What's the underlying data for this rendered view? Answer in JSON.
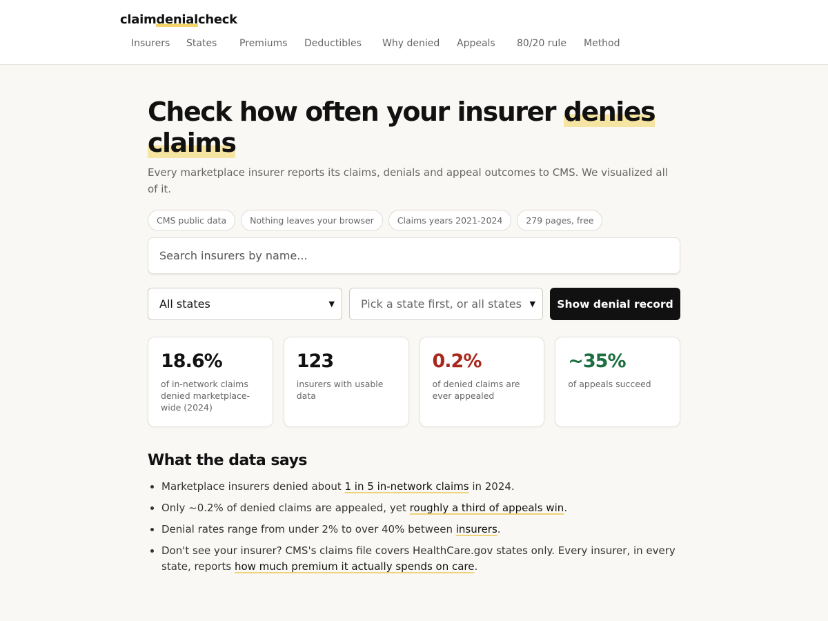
{
  "header": {
    "logo": {
      "part1": "claim",
      "part2": "denial",
      "part3": "check"
    },
    "nav": [
      "Insurers",
      "States",
      "Premiums",
      "Deductibles",
      "Why denied",
      "Appeals",
      "80/20 rule",
      "Method"
    ]
  },
  "hero": {
    "title_part1": "Check how often your insurer ",
    "title_highlight1": "denies",
    "title_highlight2": "claims",
    "subtitle": "Every marketplace insurer reports its claims, denials and appeal outcomes to CMS. We visualized all of it.",
    "chips": [
      "CMS public data",
      "Nothing leaves your browser",
      "Claims years 2021-2024",
      "279 pages, free"
    ]
  },
  "search": {
    "placeholder": "Search insurers by name..."
  },
  "controls": {
    "state_select": "All states",
    "insurer_select": "Pick a state first, or all states",
    "button": "Show denial record"
  },
  "stats": [
    {
      "value": "18.6%",
      "label": "of in-network claims denied marketplace-wide (2024)",
      "tone": "default"
    },
    {
      "value": "123",
      "label": "insurers with usable data",
      "tone": "default"
    },
    {
      "value": "0.2%",
      "label": "of denied claims are ever appealed",
      "tone": "red"
    },
    {
      "value": "~35%",
      "label": "of appeals succeed",
      "tone": "green"
    }
  ],
  "colors": {
    "accent_highlight": "#f6e4a3",
    "red": "#a8281e",
    "green": "#1b6e3f",
    "button_bg": "#111111"
  },
  "findings": {
    "heading": "What the data says",
    "items": [
      {
        "before": "Marketplace insurers denied about ",
        "link": "1 in 5 in-network claims",
        "after": " in 2024."
      },
      {
        "before": "Only ~0.2% of denied claims are appealed, yet ",
        "link": "roughly a third of appeals win",
        "after": "."
      },
      {
        "before": "Denial rates range from under 2% to over 40% between ",
        "link": "insurers",
        "after": "."
      },
      {
        "before": "Don't see your insurer? CMS's claims file covers HealthCare.gov states only. Every insurer, in every state, reports ",
        "link": "how much premium it actually spends on care",
        "after": "."
      }
    ]
  }
}
